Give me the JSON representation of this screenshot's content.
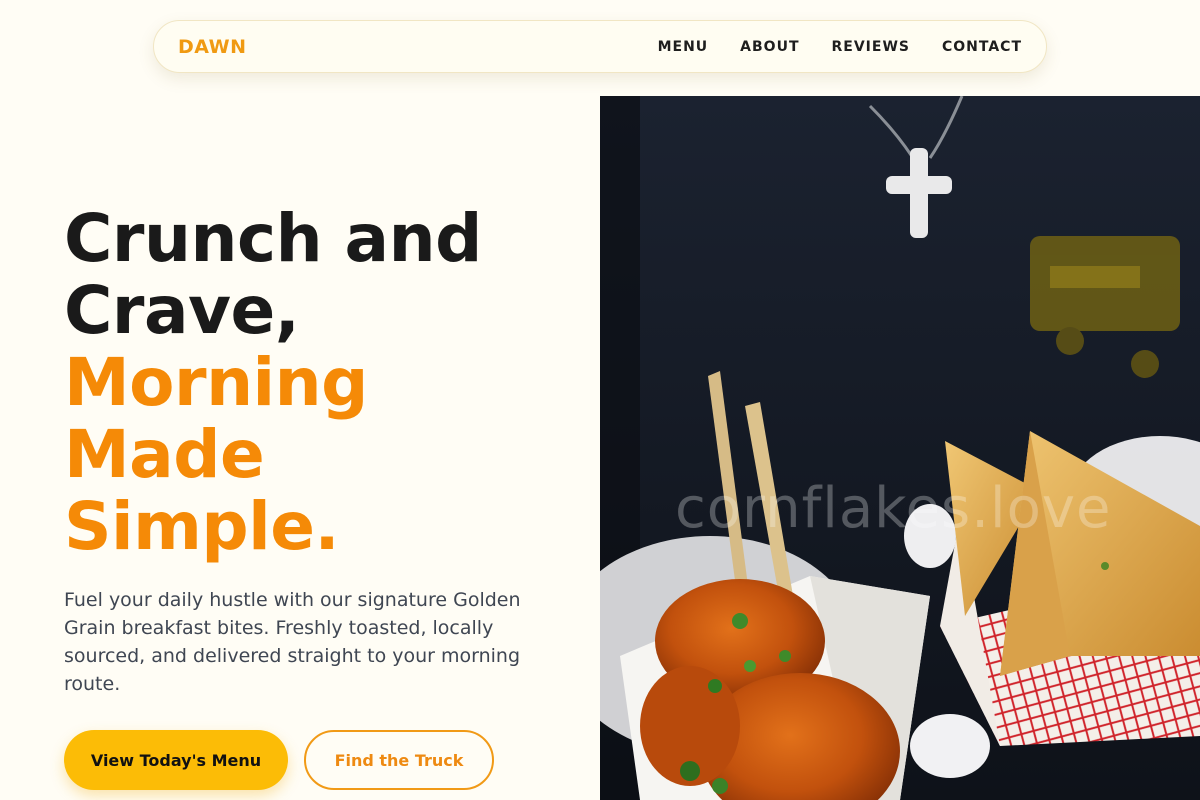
{
  "nav": {
    "brand": "DAWN",
    "links": [
      "MENU",
      "ABOUT",
      "REVIEWS",
      "CONTACT"
    ]
  },
  "hero": {
    "headline_line1": "Crunch and",
    "headline_line2": "Crave,",
    "headline_accent1": "Morning",
    "headline_accent2": "Made",
    "headline_accent3": "Simple.",
    "lead": "Fuel your daily hustle with our signature Golden Grain breakfast bites. Freshly toasted, locally sourced, and delivered straight to your morning route.",
    "primary_button": "View Today's Menu",
    "secondary_button": "Find the Truck",
    "watermark": "cornflakes.love"
  },
  "colors": {
    "brand": "#f09a12",
    "accent": "#f58a07",
    "primary_button": "#fcbc06",
    "background": "#fffdf5",
    "text": "#1a1a1a"
  }
}
